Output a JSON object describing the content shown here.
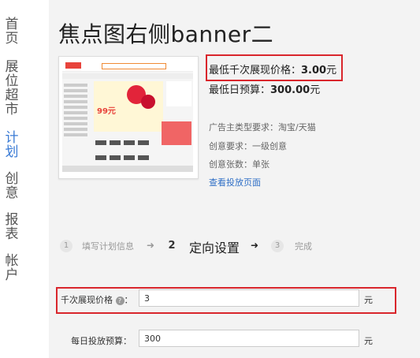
{
  "sidebar": {
    "items": [
      {
        "label": "首页",
        "chars": [
          "首",
          "页"
        ],
        "active": false
      },
      {
        "label": "展位超市",
        "chars": [
          "展",
          "位",
          "超",
          "市"
        ],
        "active": false
      },
      {
        "label": "计划",
        "chars": [
          "计",
          "划"
        ],
        "active": true
      },
      {
        "label": "创意",
        "chars": [
          "创",
          "意"
        ],
        "active": false
      },
      {
        "label": "报表",
        "chars": [
          "报",
          "表"
        ],
        "active": false
      },
      {
        "label": "帐户",
        "chars": [
          "帐",
          "户"
        ],
        "active": false
      }
    ]
  },
  "header": {
    "title": "焦点图右侧banner二"
  },
  "info": {
    "price_label": "最低千次展现价格：",
    "price_value": "3.00",
    "price_unit": "元",
    "budget_label": "最低日预算：",
    "budget_value": "300.00",
    "budget_unit": "元",
    "advertiser_type": "广告主类型要求：淘宝/天猫",
    "creative_req": "创意要求：一级创意",
    "creative_count": "创意张数：单张",
    "view_page_link": "查看投放页面"
  },
  "thumbnail": {
    "promo_text": "99元"
  },
  "steps": [
    {
      "num": "1",
      "label": "填写计划信息",
      "active": false
    },
    {
      "num": "2",
      "label": "定向设置",
      "active": true
    },
    {
      "num": "3",
      "label": "完成",
      "active": false
    }
  ],
  "form": {
    "cpm_label": "千次展现价格",
    "cpm_help": "?",
    "cpm_colon": "：",
    "cpm_value": "3",
    "cpm_unit": "元",
    "budget_label": "每日投放预算：",
    "budget_value": "300",
    "budget_unit": "元"
  },
  "colors": {
    "accent": "#3a7bd5",
    "highlight_border": "#d9262c",
    "background": "#f3f3f3"
  }
}
